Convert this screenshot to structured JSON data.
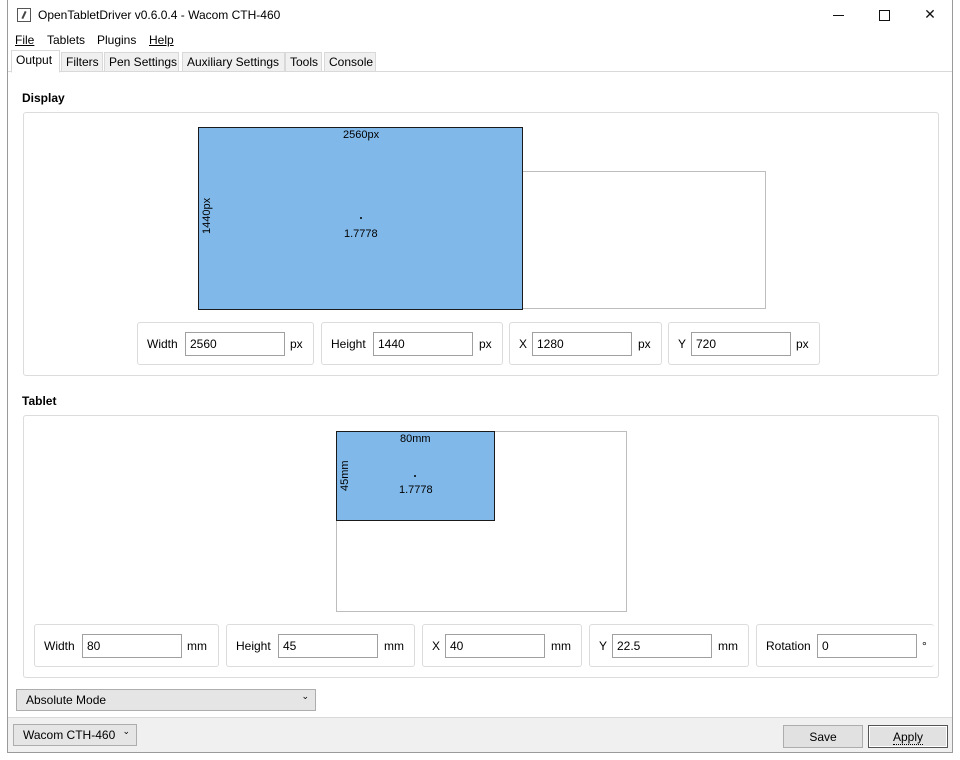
{
  "window": {
    "title": "OpenTabletDriver v0.6.0.4 - Wacom CTH-460",
    "icons": {
      "app": "app-icon",
      "minimize": "minimize-icon",
      "maximize": "maximize-icon",
      "close": "close-icon"
    }
  },
  "menu": {
    "file": "File",
    "tablets": "Tablets",
    "plugins": "Plugins",
    "help": "Help"
  },
  "tabs": [
    {
      "label": "Output",
      "active": true
    },
    {
      "label": "Filters"
    },
    {
      "label": "Pen Settings"
    },
    {
      "label": "Auxiliary Settings"
    },
    {
      "label": "Tools"
    },
    {
      "label": "Console"
    }
  ],
  "display": {
    "section_title": "Display",
    "area_width_label": "2560px",
    "area_height_label": "1440px",
    "area_ratio": "1.7778",
    "fields": {
      "width_label": "Width",
      "width_value": "2560",
      "width_unit": "px",
      "height_label": "Height",
      "height_value": "1440",
      "height_unit": "px",
      "x_label": "X",
      "x_value": "1280",
      "x_unit": "px",
      "y_label": "Y",
      "y_value": "720",
      "y_unit": "px"
    }
  },
  "tablet": {
    "section_title": "Tablet",
    "area_width_label": "80mm",
    "area_height_label": "45mm",
    "area_ratio": "1.7778",
    "fields": {
      "width_label": "Width",
      "width_value": "80",
      "width_unit": "mm",
      "height_label": "Height",
      "height_value": "45",
      "height_unit": "mm",
      "x_label": "X",
      "x_value": "40",
      "x_unit": "mm",
      "y_label": "Y",
      "y_value": "22.5",
      "y_unit": "mm",
      "rotation_label": "Rotation",
      "rotation_value": "0",
      "rotation_unit": "°"
    }
  },
  "mode_select": {
    "value": "Absolute Mode"
  },
  "footer": {
    "tablet_select": "Wacom CTH-460",
    "save_label": "Save",
    "apply_label": "Apply"
  },
  "colors": {
    "area_fill": "#80b8e9",
    "area_border": "#1a1a1a",
    "bottom_bar": "#f0f0f0"
  }
}
